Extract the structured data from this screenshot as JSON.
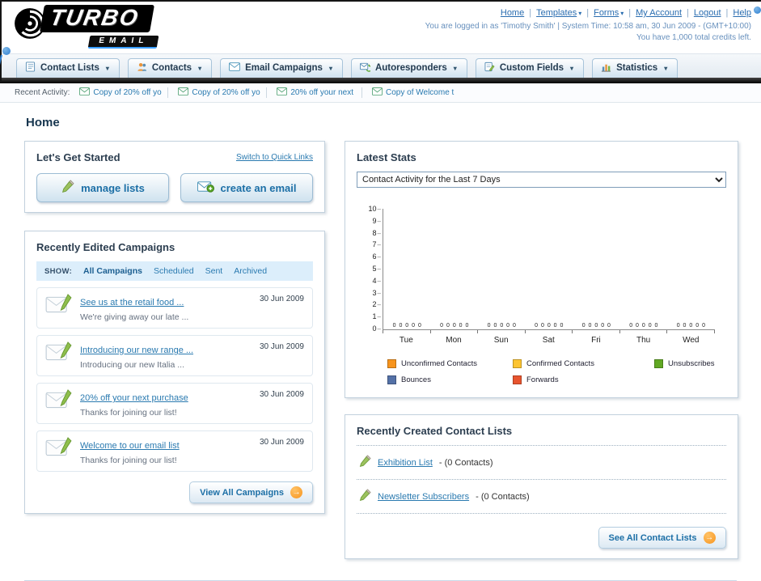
{
  "header": {
    "logo": {
      "line1": "TURBO",
      "line2": "EMAIL"
    },
    "links": [
      {
        "label": "Home"
      },
      {
        "label": "Templates",
        "dropdown": true
      },
      {
        "label": "Forms",
        "dropdown": true
      },
      {
        "label": "My Account"
      },
      {
        "label": "Logout"
      },
      {
        "label": "Help"
      }
    ],
    "session_line": "You are logged in as 'Timothy Smith' | System Time: 10:58 am, 30 Jun 2009 - (GMT+10:00)",
    "credits_line": "You have 1,000 total credits left."
  },
  "nav": {
    "tabs": [
      {
        "label": "Contact Lists"
      },
      {
        "label": "Contacts"
      },
      {
        "label": "Email Campaigns"
      },
      {
        "label": "Autoresponders"
      },
      {
        "label": "Custom Fields"
      },
      {
        "label": "Statistics"
      }
    ]
  },
  "recent_activity": {
    "label": "Recent Activity:",
    "items": [
      {
        "label": "Copy of 20% off yo"
      },
      {
        "label": "Copy of 20% off yo"
      },
      {
        "label": "20% off your next"
      },
      {
        "label": "Copy of Welcome t"
      }
    ]
  },
  "page": {
    "title": "Home"
  },
  "get_started": {
    "title": "Let's Get Started",
    "switch_link": "Switch to Quick Links",
    "manage_button": "manage lists",
    "create_button": "create an email"
  },
  "campaigns": {
    "title": "Recently Edited Campaigns",
    "show_label": "SHOW:",
    "filters": [
      {
        "label": "All Campaigns",
        "active": true
      },
      {
        "label": "Scheduled"
      },
      {
        "label": "Sent"
      },
      {
        "label": "Archived"
      }
    ],
    "rows": [
      {
        "title": "See us at the retail food ...",
        "subtitle": "We're giving away our late ...",
        "date": "30 Jun 2009"
      },
      {
        "title": "Introducing our new range ...",
        "subtitle": "Introducing our new Italia ...",
        "date": "30 Jun 2009"
      },
      {
        "title": "20% off your next purchase",
        "subtitle": "Thanks for joining our list!",
        "date": "30 Jun 2009"
      },
      {
        "title": "Welcome to our email list",
        "subtitle": "Thanks for joining our list!",
        "date": "30 Jun 2009"
      }
    ],
    "view_all_label": "View All Campaigns"
  },
  "stats": {
    "title": "Latest Stats",
    "range_selected": "Contact Activity for the Last 7 Days",
    "chart_data": {
      "type": "bar",
      "title": "Contact Activity for the Last 7 Days",
      "categories": [
        "Tue",
        "Mon",
        "Sun",
        "Sat",
        "Fri",
        "Thu",
        "Wed"
      ],
      "series": [
        {
          "name": "Unconfirmed Contacts",
          "color": "#f7941d",
          "values": [
            0,
            0,
            0,
            0,
            0,
            0,
            0
          ]
        },
        {
          "name": "Confirmed Contacts",
          "color": "#fdc431",
          "values": [
            0,
            0,
            0,
            0,
            0,
            0,
            0
          ]
        },
        {
          "name": "Unsubscribes",
          "color": "#61a823",
          "values": [
            0,
            0,
            0,
            0,
            0,
            0,
            0
          ]
        },
        {
          "name": "Bounces",
          "color": "#5471a7",
          "values": [
            0,
            0,
            0,
            0,
            0,
            0,
            0
          ]
        },
        {
          "name": "Forwards",
          "color": "#e8542e",
          "values": [
            0,
            0,
            0,
            0,
            0,
            0,
            0
          ]
        }
      ],
      "ylim": [
        0,
        10
      ],
      "y_ticks": [
        "10",
        "9",
        "8",
        "7",
        "6",
        "5",
        "4",
        "3",
        "2",
        "1",
        "0"
      ],
      "bar_label_row": "0 0 0 0 0",
      "grid": false,
      "legend_position": "bottom"
    }
  },
  "contact_lists": {
    "title": "Recently Created Contact Lists",
    "items": [
      {
        "name": "Exhibition List",
        "suffix": "- (0 Contacts)"
      },
      {
        "name": "Newsletter Subscribers",
        "suffix": "- (0 Contacts)"
      }
    ],
    "see_all_label": "See All Contact Lists"
  }
}
